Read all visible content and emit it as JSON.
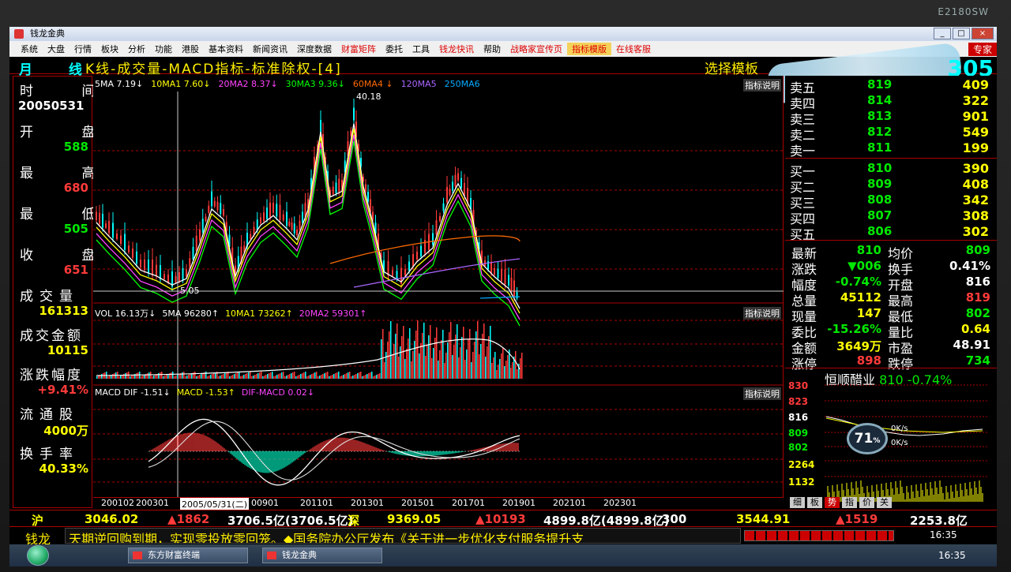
{
  "bezel": {
    "label": "E2180SW"
  },
  "window": {
    "title": "钱龙金典",
    "btn_min": "_",
    "btn_max": "□",
    "btn_close": "×"
  },
  "menu": {
    "items": [
      "系统",
      "大盘",
      "行情",
      "板块",
      "分析",
      "功能",
      "港股",
      "基本资料",
      "新闻资讯",
      "深度数据",
      "财富矩阵",
      "委托",
      "工具",
      "钱龙快讯",
      "帮助",
      "战略家宣传页",
      "指标模版",
      "在线客服"
    ],
    "red_items": [
      "财富矩阵",
      "钱龙快讯",
      "战略家宣传页",
      "指标模版",
      "在线客服"
    ],
    "right": "专家"
  },
  "toolbar": {
    "period": "月 线",
    "chart_title": "K线-成交量-MACD指标-标准除权-[4]",
    "select_template": "选择模板",
    "stock_code": "305"
  },
  "left_panel": {
    "time_label": "时 间",
    "time_value": "20050531",
    "open_label": "开 盘",
    "open_value": "588",
    "high_label": "最 高",
    "high_value": "680",
    "low_label": "最 低",
    "low_value": "505",
    "close_label": "收 盘",
    "close_value": "651",
    "volume_label": "成交量",
    "volume_value": "161313",
    "amount_label": "成交金额",
    "amount_value": "10115",
    "change_label": "涨跌幅度",
    "change_value": "+9.41%",
    "float_label": "流通股",
    "float_value": "4000万",
    "turnover_label": "换手率",
    "turnover_value": "40.33%"
  },
  "kline": {
    "ma_labels": [
      {
        "text": "5MA 7.19↓",
        "color": "#ffffff"
      },
      {
        "text": "10MA1 7.60↓",
        "color": "#ffff00"
      },
      {
        "text": "20MA2 8.37↓",
        "color": "#ff44ff"
      },
      {
        "text": "30MA3 9.36↓",
        "color": "#00ff00"
      },
      {
        "text": "60MA4 ↓",
        "color": "#ff6a00"
      },
      {
        "text": "120MA5",
        "color": "#aa66ff"
      },
      {
        "text": "250MA6",
        "color": "#00aaff"
      }
    ],
    "help": "指标说明",
    "high_mark": "40.18",
    "low_mark": "5.05"
  },
  "volume": {
    "labels": [
      {
        "text": "VOL 16.13万↓",
        "color": "#ffffff"
      },
      {
        "text": "5MA 96280↑",
        "color": "#ffffff"
      },
      {
        "text": "10MA1 73262↑",
        "color": "#ffff00"
      },
      {
        "text": "20MA2 59301↑",
        "color": "#ff44ff"
      }
    ],
    "help": "指标说明"
  },
  "macd": {
    "labels": [
      {
        "text": "MACD DIF -1.51↓",
        "color": "#ffffff"
      },
      {
        "text": "MACD -1.53↑",
        "color": "#ffff00"
      },
      {
        "text": "DIF-MACD 0.02↓",
        "color": "#ff44ff"
      }
    ],
    "help": "指标说明"
  },
  "x_axis": {
    "ticks": [
      "200102",
      "200301",
      "2005/05/31(二)",
      "00901",
      "201101",
      "201301",
      "201501",
      "201701",
      "201901",
      "202101",
      "202301"
    ]
  },
  "quotes": {
    "sell": [
      {
        "label": "卖五",
        "price": "819",
        "vol": "409"
      },
      {
        "label": "卖四",
        "price": "814",
        "vol": "322"
      },
      {
        "label": "卖三",
        "price": "813",
        "vol": "901"
      },
      {
        "label": "卖二",
        "price": "812",
        "vol": "549"
      },
      {
        "label": "卖一",
        "price": "811",
        "vol": "199"
      }
    ],
    "buy": [
      {
        "label": "买一",
        "price": "810",
        "vol": "390"
      },
      {
        "label": "买二",
        "price": "809",
        "vol": "408"
      },
      {
        "label": "买三",
        "price": "808",
        "vol": "342"
      },
      {
        "label": "买四",
        "price": "807",
        "vol": "308"
      },
      {
        "label": "买五",
        "price": "806",
        "vol": "302"
      }
    ]
  },
  "stats": [
    {
      "l1": "最新",
      "v1": "810",
      "c1": "#00e800",
      "l2": "均价",
      "v2": "809",
      "c2": "#00e800"
    },
    {
      "l1": "涨跌",
      "v1": "▼006",
      "c1": "#00e800",
      "l2": "换手",
      "v2": "0.41%",
      "c2": "#ffffff"
    },
    {
      "l1": "幅度",
      "v1": "-0.74%",
      "c1": "#00e800",
      "l2": "开盘",
      "v2": "816",
      "c2": "#ffffff"
    },
    {
      "l1": "总量",
      "v1": "45112",
      "c1": "#ffff00",
      "l2": "最高",
      "v2": "819",
      "c2": "#ff3a3a"
    },
    {
      "l1": "现量",
      "v1": "147",
      "c1": "#ffff00",
      "l2": "最低",
      "v2": "802",
      "c2": "#00e800"
    },
    {
      "l1": "委比",
      "v1": "-15.26%",
      "c1": "#00e800",
      "l2": "量比",
      "v2": "0.64",
      "c2": "#ffff00"
    },
    {
      "l1": "金额",
      "v1": "3649万",
      "c1": "#ffff00",
      "l2": "市盈",
      "v2": "48.91",
      "c2": "#ffffff"
    },
    {
      "l1": "涨停",
      "v1": "898",
      "c1": "#ff3a3a",
      "l2": "跌停",
      "v2": "734",
      "c2": "#00e800"
    }
  ],
  "mini": {
    "name": "恒顺醋业",
    "price": "810",
    "change": "-0.74%",
    "axis": [
      "830",
      "823",
      "816",
      "809",
      "802",
      "2264",
      "1132"
    ],
    "gauge": "71",
    "gauge_unit": "%",
    "up_speed": "0K/s",
    "down_speed": "0K/s"
  },
  "tabs": [
    "细",
    "板",
    "势",
    "指",
    "价",
    "关"
  ],
  "bottom_bar": [
    {
      "text": "沪",
      "color": "#ffff00"
    },
    {
      "text": "3046.02",
      "color": "#ffff00"
    },
    {
      "text": "▲1862",
      "color": "#ff3a3a"
    },
    {
      "text": "3706.5亿(3706.5亿)",
      "color": "#ffffff"
    },
    {
      "text": "深",
      "color": "#ffff00"
    },
    {
      "text": "9369.05",
      "color": "#ffff00"
    },
    {
      "text": "▲10193",
      "color": "#ff3a3a"
    },
    {
      "text": "4899.8亿(4899.8亿)",
      "color": "#ffffff"
    },
    {
      "text": "300",
      "color": "#ffffff"
    },
    {
      "text": "3544.91",
      "color": "#ffff00"
    },
    {
      "text": "▲1519",
      "color": "#ff3a3a"
    },
    {
      "text": "2253.8亿",
      "color": "#ffffff"
    }
  ],
  "ticker": {
    "logo": "钱龙",
    "text": "天期逆回购到期，实现零投放零回笼。◆国务院办公厅发布《关于进一步优化支付服务提升支",
    "time": "16:35"
  },
  "taskbar": {
    "task1": "东方财富终端",
    "task2": "钱龙金典",
    "time": "16:35"
  },
  "colors": {
    "up": "#ff3a3a",
    "down": "#00e800",
    "grid": "#aa0000",
    "accent": "#ffff00"
  }
}
